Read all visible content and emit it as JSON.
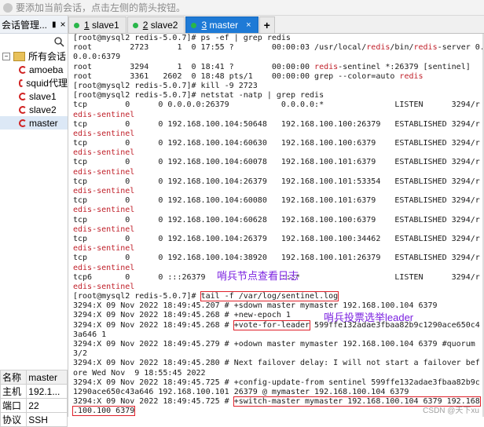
{
  "hint": {
    "text": "要添加当前会话，点击左侧的箭头按钮。"
  },
  "sidebar": {
    "title": "会话管理...",
    "pin": "𝐩",
    "close": "×",
    "root_label": "所有会话",
    "sessions": [
      "amoeba",
      "squid代理",
      "slave1",
      "slave2",
      "master"
    ],
    "selected": "master"
  },
  "properties": {
    "header": [
      "名称",
      "master"
    ],
    "rows": [
      [
        "主机",
        "192.1..."
      ],
      [
        "端口",
        "22"
      ],
      [
        "协议",
        "SSH"
      ]
    ]
  },
  "tabs": [
    {
      "num": "1",
      "label": "slave1",
      "active": false
    },
    {
      "num": "2",
      "label": "slave2",
      "active": false
    },
    {
      "num": "3",
      "label": "master",
      "active": true
    }
  ],
  "tab_plus": "+",
  "annotations": {
    "log_note": "哨兵节点查看日志",
    "leader_note": "哨兵投票选举leader"
  },
  "terminal": {
    "lines": [
      [
        {
          "t": "[root@mysql2 redis-5.0.7]# ps -ef | grep redis"
        }
      ],
      [
        {
          "t": "root        2723      1  0 17:55 ?        00:00:03 /usr/local/"
        },
        {
          "t": "redis",
          "c": "red"
        },
        {
          "t": "/bin/"
        },
        {
          "t": "redis",
          "c": "red"
        },
        {
          "t": "-server 0."
        }
      ],
      [
        {
          "t": "0.0.0:6379"
        }
      ],
      [
        {
          "t": "root        3294      1  0 18:41 ?        00:00:00 "
        },
        {
          "t": "redis",
          "c": "red"
        },
        {
          "t": "-sentinel *:26379 [sentinel]"
        }
      ],
      [
        {
          "t": "root        3361   2602  0 18:48 pts/1    00:00:00 grep --color=auto "
        },
        {
          "t": "redis",
          "c": "red"
        }
      ],
      [
        {
          "t": "[root@mysql2 redis-5.0.7]# kill -9 2723"
        }
      ],
      [
        {
          "t": "[root@mysql2 redis-5.0.7]# netstat -natp | grep redis"
        }
      ],
      [
        {
          "t": "tcp        0      0 0.0.0.0:26379           0.0.0.0:*               LISTEN      3294/r"
        }
      ],
      [
        {
          "t": "edis-sentinel",
          "c": "red"
        }
      ],
      [
        {
          "t": "tcp        0      0 192.168.100.104:50648   192.168.100.100:26379   ESTABLISHED 3294/r"
        }
      ],
      [
        {
          "t": "edis-sentinel",
          "c": "red"
        }
      ],
      [
        {
          "t": "tcp        0      0 192.168.100.104:60630   192.168.100.100:6379    ESTABLISHED 3294/r"
        }
      ],
      [
        {
          "t": "edis-sentinel",
          "c": "red"
        }
      ],
      [
        {
          "t": "tcp        0      0 192.168.100.104:60078   192.168.100.101:6379    ESTABLISHED 3294/r"
        }
      ],
      [
        {
          "t": "edis-sentinel",
          "c": "red"
        }
      ],
      [
        {
          "t": "tcp        0      0 192.168.100.104:26379   192.168.100.101:53354   ESTABLISHED 3294/r"
        }
      ],
      [
        {
          "t": "edis-sentinel",
          "c": "red"
        }
      ],
      [
        {
          "t": "tcp        0      0 192.168.100.104:60080   192.168.100.101:6379    ESTABLISHED 3294/r"
        }
      ],
      [
        {
          "t": "edis-sentinel",
          "c": "red"
        }
      ],
      [
        {
          "t": "tcp        0      0 192.168.100.104:60628   192.168.100.100:6379    ESTABLISHED 3294/r"
        }
      ],
      [
        {
          "t": "edis-sentinel",
          "c": "red"
        }
      ],
      [
        {
          "t": "tcp        0      0 192.168.100.104:26379   192.168.100.100:34462   ESTABLISHED 3294/r"
        }
      ],
      [
        {
          "t": "edis-sentinel",
          "c": "red"
        }
      ],
      [
        {
          "t": "tcp        0      0 192.168.100.104:38920   192.168.100.101:26379   ESTABLISHED 3294/r"
        }
      ],
      [
        {
          "t": "edis-sentinel",
          "c": "red"
        }
      ],
      [
        {
          "t": "tcp6       0      0 :::26379                :::*                    LISTEN      3294/r"
        }
      ],
      [
        {
          "t": "edis-sentinel",
          "c": "red"
        }
      ],
      [
        {
          "t": "[root@mysql2 redis-5.0.7]# "
        },
        {
          "t": "tail -f /var/log/sentinel.log",
          "b": true
        }
      ],
      [
        {
          "t": "3294:X 09 Nov 2022 18:49:45.207 # +sdown master mymaster 192.168.100.104 6379"
        }
      ],
      [
        {
          "t": "3294:X 09 Nov 2022 18:49:45.268 # +new-epoch 1"
        }
      ],
      [
        {
          "t": "3294:X 09 Nov 2022 18:49:45.268 # "
        },
        {
          "t": "+vote-for-leader",
          "b": true
        },
        {
          "t": " 599ffe132adae3fbaa82b9c1290ace650c4"
        }
      ],
      [
        {
          "t": "3a646 1"
        }
      ],
      [
        {
          "t": "3294:X 09 Nov 2022 18:49:45.279 # +odown master mymaster 192.168.100.104 6379 #quorum"
        }
      ],
      [
        {
          "t": "3/2"
        }
      ],
      [
        {
          "t": "3294:X 09 Nov 2022 18:49:45.280 # Next failover delay: I will not start a failover bef"
        }
      ],
      [
        {
          "t": "ore Wed Nov  9 18:55:45 2022"
        }
      ],
      [
        {
          "t": "3294:X 09 Nov 2022 18:49:45.725 # +config-update-from sentinel 599ffe132adae3fbaa82b9c"
        }
      ],
      [
        {
          "t": "1290ace650c43a646 192.168.100.101 26379 @ mymaster 192.168.100.104 6379"
        }
      ],
      [
        {
          "t": "3294:X 09 Nov 2022 18:49:45.725 # "
        },
        {
          "t": "+switch-master mymaster 192.168.100.104 6379 192.168",
          "b": true
        }
      ],
      [
        {
          "t": ".100.100 6379",
          "b": true
        }
      ]
    ]
  },
  "watermark": "CSDN @天下xu"
}
